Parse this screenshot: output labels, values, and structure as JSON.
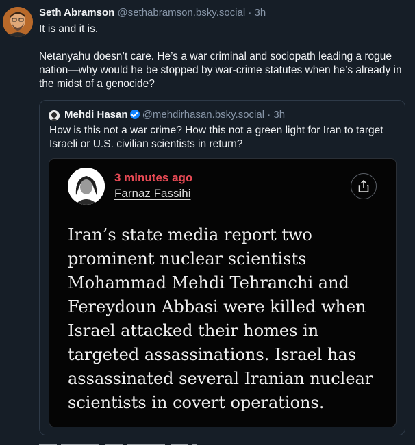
{
  "post": {
    "author_name": "Seth Abramson",
    "handle": "@sethabramson.bsky.social",
    "separator": " · ",
    "time": "3h",
    "paragraph1": "It is and it is.",
    "paragraph2": "Netanyahu doesn’t care. He’s a war criminal and sociopath leading a rogue nation—why would he be stopped by war-crime statutes when he’s already in the midst of a genocide?"
  },
  "quote": {
    "author_name": "Mehdi Hasan",
    "verified_icon": "verified-check-icon",
    "handle": "@mehdirhasan.bsky.social",
    "separator": " · ",
    "time": "3h",
    "text": "How is this not a war crime? How this not a green light for Iran to target Israeli or U.S. civilian scientists in return?",
    "embedded_image": {
      "time_ago": "3 minutes ago",
      "byline": "Farnaz Fassihi",
      "share_icon": "share-icon",
      "body": "Iran’s state media report two prominent nuclear scientists Mohammad Mehdi Tehranchi and Fereydoun Abbasi were killed when Israel attacked their homes in targeted assassinations. Israel has assassinated several Iranian nuclear scientists in covert operations."
    }
  },
  "colors": {
    "background": "#161e27",
    "handle_gray": "#8795a7",
    "verified_blue": "#1083fe",
    "timestamp_red": "#e84a55"
  }
}
